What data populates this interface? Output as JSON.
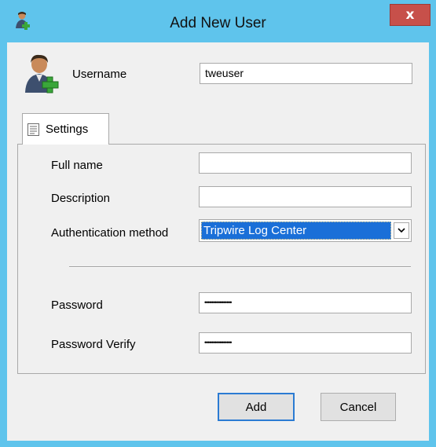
{
  "window": {
    "title": "Add New User",
    "close_label": "x",
    "app_icon": "user-add-icon",
    "colors": {
      "titlebar": "#5fc4ec",
      "close": "#c7504a",
      "selection": "#1a6fd8"
    }
  },
  "header": {
    "icon": "user-add-icon",
    "username_label": "Username",
    "username_value": "tweuser"
  },
  "tabs": [
    {
      "label": "Settings",
      "icon": "settings-page-icon",
      "selected": true
    }
  ],
  "settings": {
    "full_name_label": "Full name",
    "full_name_value": "",
    "description_label": "Description",
    "description_value": "",
    "auth_method_label": "Authentication method",
    "auth_method_value": "Tripwire Log Center",
    "password_label": "Password",
    "password_value": "••••••••••••••••",
    "password_verify_label": "Password Verify",
    "password_verify_value": "••••••••••••••••"
  },
  "buttons": {
    "add_label": "Add",
    "cancel_label": "Cancel"
  }
}
